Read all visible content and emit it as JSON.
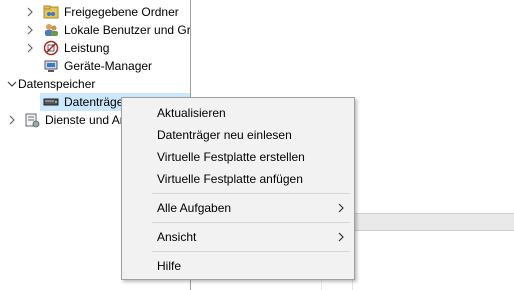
{
  "tree": {
    "items": [
      {
        "label": "Freigegebene Ordner",
        "icon": "shared-folder-icon",
        "expander": "collapsed"
      },
      {
        "label": "Lokale Benutzer und Gruppen",
        "icon": "users-icon",
        "expander": "collapsed"
      },
      {
        "label": "Leistung",
        "icon": "performance-icon",
        "expander": "collapsed"
      },
      {
        "label": "Geräte-Manager",
        "icon": "device-manager-icon",
        "expander": "none"
      },
      {
        "label": "Datenspeicher",
        "icon": "storage-icon",
        "expander": "expanded"
      },
      {
        "label": "Datenträgerverwaltung",
        "icon": "disk-icon",
        "expander": "none",
        "selected": true
      },
      {
        "label": "Dienste und Anwendungen",
        "icon": "services-icon",
        "expander": "collapsed"
      }
    ]
  },
  "context_menu": {
    "items": [
      {
        "label": "Aktualisieren"
      },
      {
        "label": "Datenträger neu einlesen"
      },
      {
        "label": "Virtuelle Festplatte erstellen"
      },
      {
        "label": "Virtuelle Festplatte anfügen"
      },
      {
        "label": "Alle Aufgaben",
        "submenu": true
      },
      {
        "label": "Ansicht",
        "submenu": true
      },
      {
        "label": "Hilfe"
      }
    ]
  },
  "colors": {
    "selection": "#cce8ff",
    "menu_background": "#f2f2f2",
    "menu_border": "#a0a0a0"
  }
}
